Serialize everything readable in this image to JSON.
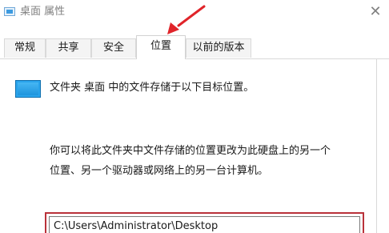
{
  "window": {
    "title": "桌面 属性",
    "close_glyph": "✕"
  },
  "tabs": [
    {
      "label": "常规",
      "active": false
    },
    {
      "label": "共享",
      "active": false
    },
    {
      "label": "安全",
      "active": false
    },
    {
      "label": "位置",
      "active": true
    },
    {
      "label": "以前的版本",
      "active": false
    }
  ],
  "location": {
    "info_text": "文件夹 桌面 中的文件存储于以下目标位置。",
    "description_line1": "你可以将此文件夹中文件存储的位置更改为此硬盘上的另一个",
    "description_line2": "位置、另一个驱动器或网络上的另一台计算机。",
    "path_value": "C:\\Users\\Administrator\\Desktop"
  },
  "annotation": {
    "arrow_color": "#e0242a",
    "highlight_color": "#b9323a"
  },
  "icons": {
    "title_icon": "desktop-folder-icon",
    "folder_icon": "desktop-folder-icon",
    "close_icon": "close-icon"
  }
}
